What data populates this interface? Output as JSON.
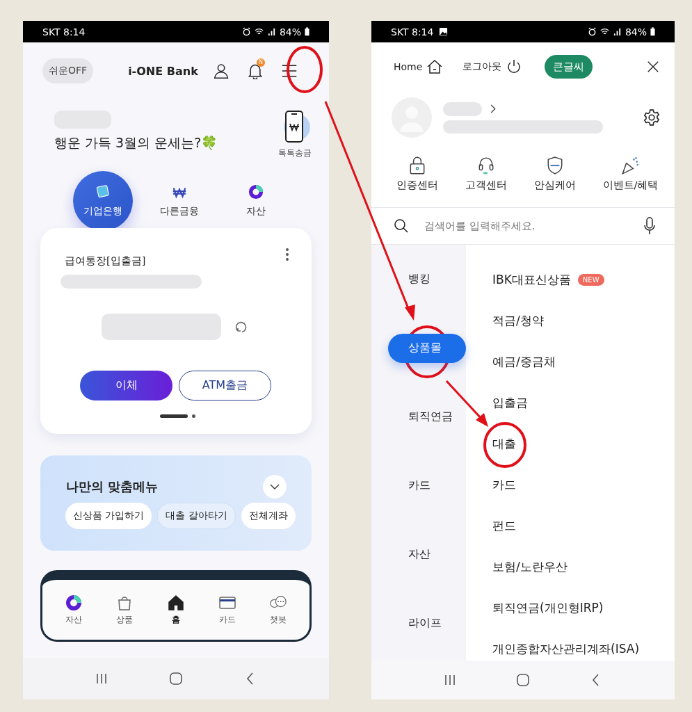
{
  "left_screen": {
    "status_bar": {
      "time": "SKT 8:14",
      "battery": "84%"
    },
    "header": {
      "easy_mode": "쉬운OFF",
      "logo": "i-ONE Bank",
      "notification_badge": "N"
    },
    "greeting": "행운 가득 3월의 운세는?🍀",
    "quick_transfer": "톡톡송금",
    "tabs": [
      {
        "label": "기업은행",
        "selected": true
      },
      {
        "label": "다른금융",
        "selected": false
      },
      {
        "label": "자산",
        "selected": false
      }
    ],
    "account_card": {
      "name": "급여통장[입출금]",
      "buttons": [
        {
          "label": "이체",
          "kind": "primary"
        },
        {
          "label": "ATM출금",
          "kind": "outline"
        }
      ],
      "pages": [
        {
          "selected": true
        },
        {
          "selected": false
        }
      ]
    },
    "custom_menu": {
      "title": "나만의 맞춤메뉴",
      "chips": [
        "신상품 가입하기",
        "대출 갈아타기",
        "전체계좌"
      ]
    },
    "bottom_nav": [
      {
        "label": "자산",
        "selected": false
      },
      {
        "label": "상품",
        "selected": false
      },
      {
        "label": "홈",
        "selected": true
      },
      {
        "label": "카드",
        "selected": false
      },
      {
        "label": "챗봇",
        "selected": false
      }
    ]
  },
  "right_screen": {
    "status_bar": {
      "time": "SKT 8:14",
      "battery": "84%"
    },
    "top_links": [
      "Home",
      "로그아웃"
    ],
    "large_text_button": "큰글씨",
    "shortcuts": [
      "인증센터",
      "고객센터",
      "안심케어",
      "이벤트/혜택"
    ],
    "search": {
      "placeholder": "검색어를 입력해주세요."
    },
    "categories": [
      {
        "label": "뱅킹",
        "selected": false
      },
      {
        "label": "상품몰",
        "selected": true
      },
      {
        "label": "퇴직연금",
        "selected": false
      },
      {
        "label": "카드",
        "selected": false
      },
      {
        "label": "자산",
        "selected": false
      },
      {
        "label": "라이프",
        "selected": false
      }
    ],
    "products": [
      {
        "label": "IBK대표신상품",
        "badge": "NEW"
      },
      {
        "label": "적금/청약"
      },
      {
        "label": "예금/중금채"
      },
      {
        "label": "입출금"
      },
      {
        "label": "대출"
      },
      {
        "label": "카드"
      },
      {
        "label": "펀드"
      },
      {
        "label": "보험/노란우산"
      },
      {
        "label": "퇴직연금(개인형IRP)"
      },
      {
        "label": "개인종합자산관리계좌(ISA)"
      }
    ]
  }
}
